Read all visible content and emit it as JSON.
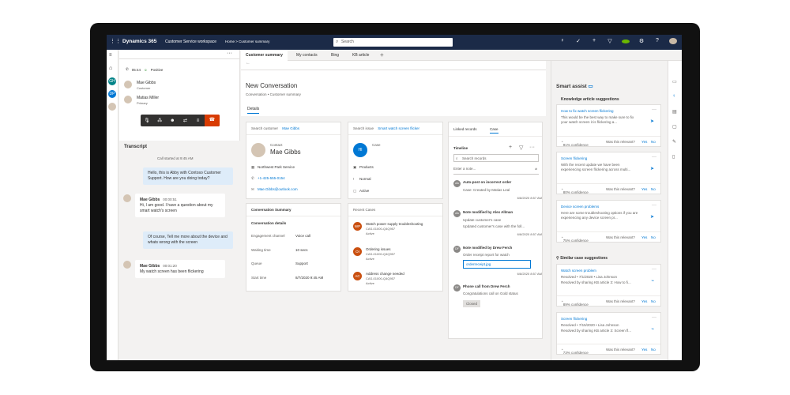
{
  "topbar": {
    "app_name": "Dynamics 365",
    "workspace": "Customer Service workspace",
    "breadcrumb": "Home  >  Customer summary",
    "search_placeholder": "Search"
  },
  "rail": {
    "items": [
      "GH",
      "DP"
    ]
  },
  "session": {
    "call_timer": "05:44",
    "sentiment": "Positive",
    "parties": [
      {
        "name": "Mae Gibbs",
        "role": "Customer"
      },
      {
        "name": "Matias Miller",
        "role": "Primary"
      }
    ]
  },
  "transcript": {
    "title": "Transcript",
    "start": "Call started at 9:45 AM",
    "messages": [
      {
        "type": "agent",
        "text": "Hello, this is Abby with Contoso Customer Support. How are you doing today?"
      },
      {
        "type": "customer",
        "name": "Mae Gibbs",
        "time": "00:00:51",
        "text": "Hi, I am good. I have a question about my smart watch's screen"
      },
      {
        "type": "agent",
        "text": "Of course, Tell me more about the device and whats wrong with the screen"
      },
      {
        "type": "customer",
        "name": "Mae Gibbs",
        "time": "00:01:20",
        "text": "My watch screen has been flickering"
      }
    ]
  },
  "tabs": [
    "Customer summary",
    "My contacts",
    "Bing",
    "KB article"
  ],
  "form": {
    "title": "New Conversation",
    "subtitle": "Conversation • Customer summary",
    "tab": "Details"
  },
  "customer": {
    "search_label": "Search customer",
    "search_value": "Mae Gibbs",
    "type": "Contact",
    "name": "Mae Gibbs",
    "company": "Northwest Park Service",
    "phone": "+1-425-555-0154",
    "email": "Mae.Gibbs@outlook.com"
  },
  "conversation_summary": {
    "title": "Conversation Summary",
    "section": "Conversation details",
    "rows": [
      {
        "label": "Engagement channel",
        "value": "Voice call"
      },
      {
        "label": "Waiting time",
        "value": "10 secs"
      },
      {
        "label": "Queue",
        "value": "Support"
      },
      {
        "label": "Start time",
        "value": "8/7/2020 9:45 AM"
      }
    ]
  },
  "issue": {
    "search_label": "Search issue",
    "search_value": "Smart watch screen flicker",
    "initials": "HI",
    "type": "Case",
    "product": "Products",
    "priority": "Normal",
    "status": "Active"
  },
  "recent_cases": {
    "title": "Recent Cases",
    "items": [
      {
        "badge": "WP",
        "color": "#ca5010",
        "title": "Watch power supply troubleshooting",
        "id": "CAS-01000-Q4Q957",
        "status": "Active"
      },
      {
        "badge": "OI",
        "color": "#ca5010",
        "title": "Ordering issues",
        "id": "CAS-01000-Q4Q957",
        "status": "Active"
      },
      {
        "badge": "AC",
        "color": "#ca5010",
        "title": "Address change needed",
        "id": "CAS-01000-Q4Q957",
        "status": "Active"
      }
    ]
  },
  "timeline": {
    "tabs": [
      "Linked records",
      "Case"
    ],
    "title": "Timeline",
    "search_placeholder": "Search records",
    "note_placeholder": "Enter a note...",
    "items": [
      {
        "initials": "AA",
        "title": "Auto-post on incorrect order",
        "line1": "Case: Created by Matias Leal",
        "date": "6/8/2020 8:57 AM"
      },
      {
        "initials": "AA",
        "title": "Note modified by Alex Allman",
        "line1": "Update customer's case",
        "line2": "Updated customer's case with the foll...",
        "date": "6/8/2020 8:57 AM"
      },
      {
        "initials": "DF",
        "title": "Note modified by Drew Ferch",
        "line1": "Order receipt report for watch",
        "attachment": "orderreceipt.jpg",
        "date": "6/8/2020 8:57 AM"
      },
      {
        "initials": "DF",
        "title": "Phone call from Drew Ferch",
        "line1": "Congratulations call on Gold status",
        "status": "Closed"
      }
    ]
  },
  "smart_assist": {
    "title": "Smart assist",
    "kb_title": "Knowledge article suggestions",
    "similar_title": "Similar case suggestions",
    "relevance_q": "Was this relevant?",
    "yes": "Yes",
    "no": "No",
    "kb": [
      {
        "title": "How to fix watch screen flickering",
        "desc": "This would be the best way to make sure to fix your watch screen it is flickering a...",
        "confidence": "91% confidence"
      },
      {
        "title": "Screen flickering",
        "desc": "With the recent update we have been experiencing screen flickering across multi...",
        "confidence": "80% confidence"
      },
      {
        "title": "Device screen problems",
        "desc": "Here are some troubleshooting options if you are experiencing any device screen pr...",
        "confidence": "75% confidence"
      }
    ],
    "similar": [
      {
        "title": "Watch screen problem",
        "desc": "Resolved • 7/1/2020 • Lisa Johnson",
        "desc2": "Resolved by sharing KB article 3: How to fi...",
        "confidence": "89% confidence"
      },
      {
        "title": "Screen flickering",
        "desc": "Resolved • 7/15/2020 • Lisa Johnson",
        "desc2": "Resolved by sharing KB article 3: Screen fl...",
        "confidence": "73% confidence"
      }
    ]
  }
}
